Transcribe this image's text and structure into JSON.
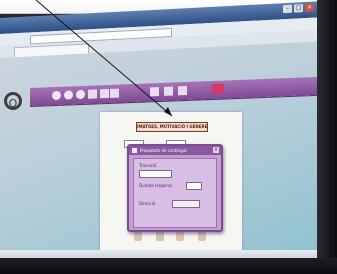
{
  "browser": {
    "title_text": "",
    "address": "",
    "tab_label": "",
    "nav_tools_text": "",
    "page_tools_text": ""
  },
  "app": {
    "logo_letter": "Q",
    "logo_text": "",
    "toolbar_text": ""
  },
  "document": {
    "title": "IMATGES, MOTIVACIÓ I GÈNERE",
    "box_left": "",
    "box_right": ""
  },
  "dialog": {
    "title": "Propietats de contingut",
    "label_1": "Transició",
    "select_1": "",
    "label_2": "Durada (segons)",
    "num_2": "",
    "label_3": "Direcció",
    "select_3": ""
  },
  "status": {
    "zoom": ""
  },
  "colors": {
    "toolbar_purple": "#8c5aa2",
    "dialog_purple": "#c59ed4",
    "screen_teal": "#8fc2cf",
    "bezel": "#161619"
  }
}
